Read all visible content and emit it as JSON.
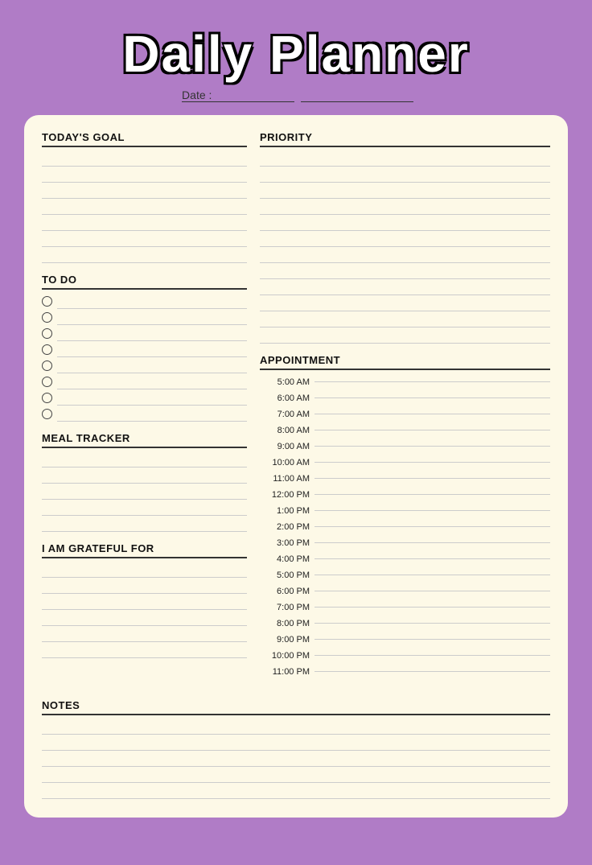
{
  "title": "Daily Planner",
  "date_label": "Date :",
  "sections": {
    "todays_goal": {
      "label": "TODAY'S GOAL",
      "lines": 7
    },
    "priority": {
      "label": "PRIORITY",
      "lines": 12
    },
    "todo": {
      "label": "TO DO",
      "items": 8
    },
    "appointment": {
      "label": "APPOINTMENT",
      "times": [
        "5:00 AM",
        "6:00 AM",
        "7:00 AM",
        "8:00 AM",
        "9:00 AM",
        "10:00 AM",
        "11:00 AM",
        "12:00 PM",
        "1:00 PM",
        "2:00 PM",
        "3:00 PM",
        "4:00 PM",
        "5:00 PM",
        "6:00 PM",
        "7:00 PM",
        "8:00 PM",
        "9:00 PM",
        "10:00 PM",
        "11:00 PM"
      ]
    },
    "meal_tracker": {
      "label": "MEAL TRACKER",
      "lines": 5
    },
    "grateful": {
      "label": "I AM GRATEFUL FOR",
      "lines": 6
    },
    "notes": {
      "label": "NOTES",
      "lines": 5
    }
  },
  "colors": {
    "background": "#b07cc6",
    "card": "#fdf9e7",
    "title_text": "#ffffff",
    "title_shadow": "#000000"
  }
}
